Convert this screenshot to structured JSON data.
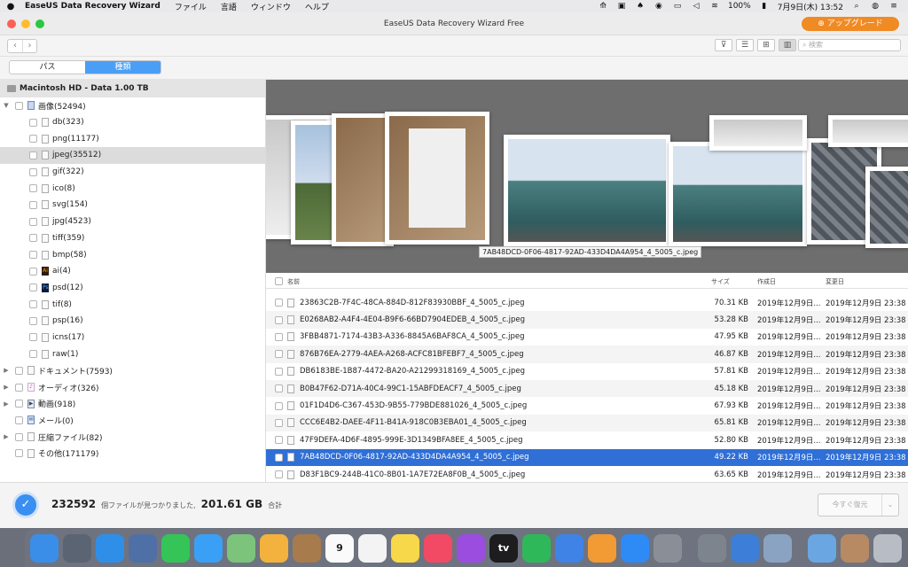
{
  "menubar": {
    "apple": "",
    "app_name": "EaseUS Data Recovery Wizard",
    "menus": [
      "ファイル",
      "言語",
      "ウィンドウ",
      "ヘルプ"
    ],
    "battery": "100%",
    "datetime": "7月9日(木)  13:52"
  },
  "window": {
    "title": "EaseUS Data Recovery Wizard Free",
    "upgrade_label": "アップグレード",
    "search_placeholder": "検索"
  },
  "segment": {
    "path_label": "パス",
    "type_label": "種類"
  },
  "sidebar": {
    "drive": "Macintosh HD - Data 1.00 TB",
    "items": [
      {
        "label": "画像(52494)",
        "level": 0,
        "disclosure": "▼",
        "icon": "folder-icon"
      },
      {
        "label": "db(323)",
        "level": 1,
        "icon": "file-icon"
      },
      {
        "label": "png(11177)",
        "level": 1,
        "icon": "image-file-icon"
      },
      {
        "label": "jpeg(35512)",
        "level": 1,
        "icon": "image-file-icon",
        "selected": true
      },
      {
        "label": "gif(322)",
        "level": 1,
        "icon": "image-file-icon"
      },
      {
        "label": "ico(8)",
        "level": 1,
        "icon": "image-file-icon"
      },
      {
        "label": "svg(154)",
        "level": 1,
        "icon": "image-file-icon"
      },
      {
        "label": "jpg(4523)",
        "level": 1,
        "icon": "image-file-icon"
      },
      {
        "label": "tiff(359)",
        "level": 1,
        "icon": "image-file-icon"
      },
      {
        "label": "bmp(58)",
        "level": 1,
        "icon": "image-file-icon"
      },
      {
        "label": "ai(4)",
        "level": 1,
        "icon": "illustrator-file-icon"
      },
      {
        "label": "psd(12)",
        "level": 1,
        "icon": "photoshop-file-icon"
      },
      {
        "label": "tif(8)",
        "level": 1,
        "icon": "image-file-icon"
      },
      {
        "label": "psp(16)",
        "level": 1,
        "icon": "image-file-icon"
      },
      {
        "label": "icns(17)",
        "level": 1,
        "icon": "image-file-icon"
      },
      {
        "label": "raw(1)",
        "level": 1,
        "icon": "image-file-icon"
      },
      {
        "label": "ドキュメント(7593)",
        "level": 0,
        "disclosure": "▶",
        "icon": "document-icon"
      },
      {
        "label": "オーディオ(326)",
        "level": 0,
        "disclosure": "▶",
        "icon": "music-icon"
      },
      {
        "label": "動画(918)",
        "level": 0,
        "disclosure": "▶",
        "icon": "video-icon"
      },
      {
        "label": "メール(0)",
        "level": 0,
        "icon": "mail-icon"
      },
      {
        "label": "圧縮ファイル(82)",
        "level": 0,
        "disclosure": "▶",
        "icon": "archive-icon"
      },
      {
        "label": "その他(171179)",
        "level": 0,
        "icon": "file-icon"
      }
    ]
  },
  "preview": {
    "caption": "7AB48DCD-0F06-4817-92AD-433D4DA4A954_4_5005_c.jpeg"
  },
  "table": {
    "headers": {
      "name": "名前",
      "size": "サイズ",
      "created": "作成日",
      "modified": "変更日"
    },
    "rows": [
      {
        "name": "23863C2B-7F4C-48CA-884D-812F83930BBF_4_5005_c.jpeg",
        "size": "70.31 KB",
        "created": "2019年12月9日...",
        "modified": "2019年12月9日 23:38"
      },
      {
        "name": "E0268AB2-A4F4-4E04-B9F6-66BD7904EDEB_4_5005_c.jpeg",
        "size": "53.28 KB",
        "created": "2019年12月9日...",
        "modified": "2019年12月9日 23:38"
      },
      {
        "name": "3FBB4871-7174-43B3-A336-8845A6BAF8CA_4_5005_c.jpeg",
        "size": "47.95 KB",
        "created": "2019年12月9日...",
        "modified": "2019年12月9日 23:38"
      },
      {
        "name": "876B76EA-2779-4AEA-A268-ACFC81BFEBF7_4_5005_c.jpeg",
        "size": "46.87 KB",
        "created": "2019年12月9日...",
        "modified": "2019年12月9日 23:38"
      },
      {
        "name": "DB6183BE-1B87-4472-BA20-A21299318169_4_5005_c.jpeg",
        "size": "57.81 KB",
        "created": "2019年12月9日...",
        "modified": "2019年12月9日 23:38"
      },
      {
        "name": "B0B47F62-D71A-40C4-99C1-15ABFDEACF7_4_5005_c.jpeg",
        "size": "45.18 KB",
        "created": "2019年12月9日...",
        "modified": "2019年12月9日 23:38"
      },
      {
        "name": "01F1D4D6-C367-453D-9B55-779BDE881026_4_5005_c.jpeg",
        "size": "67.93 KB",
        "created": "2019年12月9日...",
        "modified": "2019年12月9日 23:38"
      },
      {
        "name": "CCC6E4B2-DAEE-4F11-B41A-918C0B3EBA01_4_5005_c.jpeg",
        "size": "65.81 KB",
        "created": "2019年12月9日...",
        "modified": "2019年12月9日 23:38"
      },
      {
        "name": "47F9DEFA-4D6F-4895-999E-3D1349BFA8EE_4_5005_c.jpeg",
        "size": "52.80 KB",
        "created": "2019年12月9日...",
        "modified": "2019年12月9日 23:38"
      },
      {
        "name": "7AB48DCD-0F06-4817-92AD-433D4DA4A954_4_5005_c.jpeg",
        "size": "49.22 KB",
        "created": "2019年12月9日...",
        "modified": "2019年12月9日 23:38",
        "selected": true
      },
      {
        "name": "D83F1BC9-244B-41C0-8B01-1A7E72EA8F0B_4_5005_c.jpeg",
        "size": "63.65 KB",
        "created": "2019年12月9日...",
        "modified": "2019年12月9日 23:38"
      }
    ]
  },
  "footer": {
    "count": "232592",
    "found_text": "個ファイルが見つかりました,",
    "total_size": "201.61 GB",
    "total_suffix": "合計",
    "recover_label": "今すぐ復元"
  },
  "dock": {
    "apps": [
      {
        "name": "finder-icon",
        "color": "#3b8ee8"
      },
      {
        "name": "launchpad-icon",
        "color": "#5a6473"
      },
      {
        "name": "safari-icon",
        "color": "#2f8fe8"
      },
      {
        "name": "mail-stamp-icon",
        "color": "#4f6fa7"
      },
      {
        "name": "facetime-icon",
        "color": "#35c457"
      },
      {
        "name": "messages-icon",
        "color": "#3aa0f5"
      },
      {
        "name": "maps-icon",
        "color": "#7cc37b"
      },
      {
        "name": "photos-icon",
        "color": "#f3b13d"
      },
      {
        "name": "contacts-icon",
        "color": "#a77b4b"
      },
      {
        "name": "calendar-icon",
        "color": "#fafafa",
        "text": "9"
      },
      {
        "name": "reminders-icon",
        "color": "#f3f3f3"
      },
      {
        "name": "notes-icon",
        "color": "#f7d84a"
      },
      {
        "name": "music-icon",
        "color": "#f24a64"
      },
      {
        "name": "podcasts-icon",
        "color": "#9b4de0"
      },
      {
        "name": "tv-icon",
        "color": "#1d1d1f",
        "text": "tv"
      },
      {
        "name": "numbers-icon",
        "color": "#2fb85a"
      },
      {
        "name": "keynote-icon",
        "color": "#3f83e6"
      },
      {
        "name": "pages-icon",
        "color": "#f29a33"
      },
      {
        "name": "app-store-icon",
        "color": "#2e8af5"
      },
      {
        "name": "system-preferences-icon",
        "color": "#8a8f97"
      },
      {
        "name": "separator"
      },
      {
        "name": "script-editor-icon",
        "color": "#7d848d"
      },
      {
        "name": "easeus-icon",
        "color": "#3d7fd8"
      },
      {
        "name": "preview-icon",
        "color": "#8aa3c2"
      },
      {
        "name": "separator"
      },
      {
        "name": "downloads-folder-icon",
        "color": "#6aa6e2"
      },
      {
        "name": "screenshot-stack-icon",
        "color": "#b78a63"
      },
      {
        "name": "trash-icon",
        "color": "#b8bcc4"
      }
    ]
  }
}
